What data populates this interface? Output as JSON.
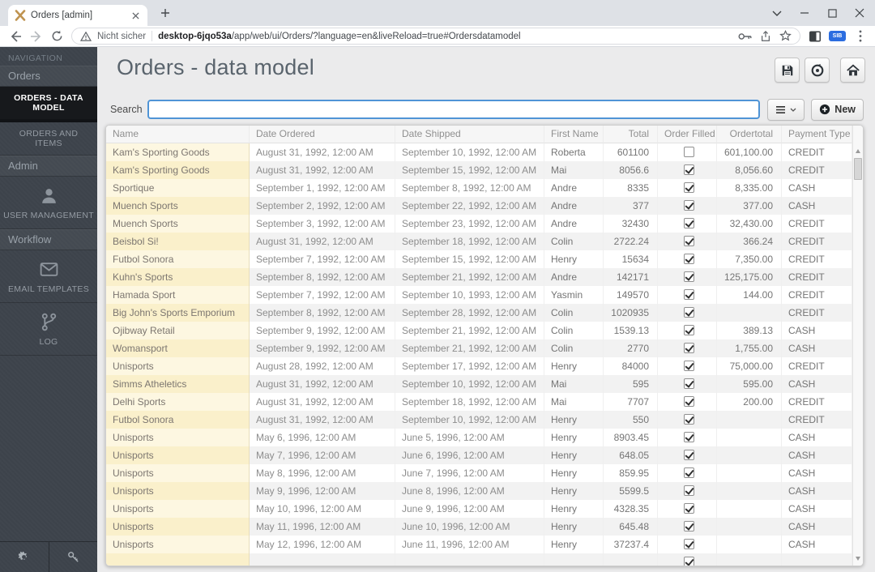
{
  "browser": {
    "tab_title": "Orders [admin]",
    "security_text": "Nicht sicher",
    "url_host": "desktop-6jqo53a",
    "url_rest": "/app/web/ui/Orders/?language=en&liveReload=true#Ordersdatamodel",
    "extension_badge": "SIB"
  },
  "colors": {
    "accent_blue": "#4f94d6",
    "sidebar_bg": "#3d434b",
    "active_item_bg": "#17191c",
    "name_cell_bg": "#fdf7e1",
    "badge_blue": "#2b6de0"
  },
  "sidebar": {
    "items": [
      {
        "type": "caption",
        "label": "NAVIGATION"
      },
      {
        "type": "group",
        "label": "Orders"
      },
      {
        "type": "item",
        "label": "ORDERS - DATA MODEL",
        "active": true
      },
      {
        "type": "item",
        "label": "ORDERS AND ITEMS",
        "active": false
      },
      {
        "type": "group",
        "label": "Admin"
      },
      {
        "type": "icon-item",
        "icon": "user-icon",
        "label": "USER MANAGEMENT"
      },
      {
        "type": "group",
        "label": "Workflow"
      },
      {
        "type": "icon-item",
        "icon": "envelope-icon",
        "label": "EMAIL TEMPLATES"
      },
      {
        "type": "icon-item",
        "icon": "branch-icon",
        "label": "LOG"
      }
    ],
    "footer": [
      {
        "icon": "gear-icon"
      },
      {
        "icon": "key-icon"
      }
    ]
  },
  "main": {
    "title": "Orders - data model",
    "search_label": "Search",
    "search_value": "",
    "new_button_label": "New"
  },
  "table": {
    "columns": [
      {
        "key": "name",
        "label": "Name",
        "align": "left"
      },
      {
        "key": "date_ordered",
        "label": "Date Ordered",
        "align": "left"
      },
      {
        "key": "date_shipped",
        "label": "Date Shipped",
        "align": "left"
      },
      {
        "key": "first_name",
        "label": "First Name",
        "align": "left"
      },
      {
        "key": "total",
        "label": "Total",
        "align": "right"
      },
      {
        "key": "order_filled",
        "label": "Order Filled",
        "align": "center",
        "type": "checkbox"
      },
      {
        "key": "ordertotal",
        "label": "Ordertotal",
        "align": "right"
      },
      {
        "key": "payment_type",
        "label": "Payment Type",
        "align": "left"
      }
    ],
    "rows": [
      {
        "name": "Kam's Sporting Goods",
        "date_ordered": "August 31, 1992, 12:00 AM",
        "date_shipped": "September 10, 1992, 12:00 AM",
        "first_name": "Roberta",
        "total": "601100",
        "order_filled": false,
        "ordertotal": "601,100.00",
        "payment_type": "CREDIT"
      },
      {
        "name": "Kam's Sporting Goods",
        "date_ordered": "August 31, 1992, 12:00 AM",
        "date_shipped": "September 15, 1992, 12:00 AM",
        "first_name": "Mai",
        "total": "8056.6",
        "order_filled": true,
        "ordertotal": "8,056.60",
        "payment_type": "CREDIT"
      },
      {
        "name": "Sportique",
        "date_ordered": "September 1, 1992, 12:00 AM",
        "date_shipped": "September 8, 1992, 12:00 AM",
        "first_name": "Andre",
        "total": "8335",
        "order_filled": true,
        "ordertotal": "8,335.00",
        "payment_type": "CASH"
      },
      {
        "name": "Muench Sports",
        "date_ordered": "September 2, 1992, 12:00 AM",
        "date_shipped": "September 22, 1992, 12:00 AM",
        "first_name": "Andre",
        "total": "377",
        "order_filled": true,
        "ordertotal": "377.00",
        "payment_type": "CASH"
      },
      {
        "name": "Muench Sports",
        "date_ordered": "September 3, 1992, 12:00 AM",
        "date_shipped": "September 23, 1992, 12:00 AM",
        "first_name": "Andre",
        "total": "32430",
        "order_filled": true,
        "ordertotal": "32,430.00",
        "payment_type": "CREDIT"
      },
      {
        "name": "Beisbol Si!",
        "date_ordered": "August 31, 1992, 12:00 AM",
        "date_shipped": "September 18, 1992, 12:00 AM",
        "first_name": "Colin",
        "total": "2722.24",
        "order_filled": true,
        "ordertotal": "366.24",
        "payment_type": "CREDIT"
      },
      {
        "name": "Futbol Sonora",
        "date_ordered": "September 7, 1992, 12:00 AM",
        "date_shipped": "September 15, 1992, 12:00 AM",
        "first_name": "Henry",
        "total": "15634",
        "order_filled": true,
        "ordertotal": "7,350.00",
        "payment_type": "CREDIT"
      },
      {
        "name": "Kuhn's Sports",
        "date_ordered": "September 8, 1992, 12:00 AM",
        "date_shipped": "September 21, 1992, 12:00 AM",
        "first_name": "Andre",
        "total": "142171",
        "order_filled": true,
        "ordertotal": "125,175.00",
        "payment_type": "CREDIT"
      },
      {
        "name": "Hamada Sport",
        "date_ordered": "September 7, 1992, 12:00 AM",
        "date_shipped": "September 10, 1993, 12:00 AM",
        "first_name": "Yasmin",
        "total": "149570",
        "order_filled": true,
        "ordertotal": "144.00",
        "payment_type": "CREDIT"
      },
      {
        "name": "Big John's Sports Emporium",
        "date_ordered": "September 8, 1992, 12:00 AM",
        "date_shipped": "September 28, 1992, 12:00 AM",
        "first_name": "Colin",
        "total": "1020935",
        "order_filled": true,
        "ordertotal": "",
        "payment_type": "CREDIT"
      },
      {
        "name": "Ojibway Retail",
        "date_ordered": "September 9, 1992, 12:00 AM",
        "date_shipped": "September 21, 1992, 12:00 AM",
        "first_name": "Colin",
        "total": "1539.13",
        "order_filled": true,
        "ordertotal": "389.13",
        "payment_type": "CASH"
      },
      {
        "name": "Womansport",
        "date_ordered": "September 9, 1992, 12:00 AM",
        "date_shipped": "September 21, 1992, 12:00 AM",
        "first_name": "Colin",
        "total": "2770",
        "order_filled": true,
        "ordertotal": "1,755.00",
        "payment_type": "CASH"
      },
      {
        "name": "Unisports",
        "date_ordered": "August 28, 1992, 12:00 AM",
        "date_shipped": "September 17, 1992, 12:00 AM",
        "first_name": "Henry",
        "total": "84000",
        "order_filled": true,
        "ordertotal": "75,000.00",
        "payment_type": "CREDIT"
      },
      {
        "name": "Simms Atheletics",
        "date_ordered": "August 31, 1992, 12:00 AM",
        "date_shipped": "September 10, 1992, 12:00 AM",
        "first_name": "Mai",
        "total": "595",
        "order_filled": true,
        "ordertotal": "595.00",
        "payment_type": "CASH"
      },
      {
        "name": "Delhi Sports",
        "date_ordered": "August 31, 1992, 12:00 AM",
        "date_shipped": "September 18, 1992, 12:00 AM",
        "first_name": "Mai",
        "total": "7707",
        "order_filled": true,
        "ordertotal": "200.00",
        "payment_type": "CREDIT"
      },
      {
        "name": "Futbol Sonora",
        "date_ordered": "August 31, 1992, 12:00 AM",
        "date_shipped": "September 10, 1992, 12:00 AM",
        "first_name": "Henry",
        "total": "550",
        "order_filled": true,
        "ordertotal": "",
        "payment_type": "CREDIT"
      },
      {
        "name": "Unisports",
        "date_ordered": "May 6, 1996, 12:00 AM",
        "date_shipped": "June 5, 1996, 12:00 AM",
        "first_name": "Henry",
        "total": "8903.45",
        "order_filled": true,
        "ordertotal": "",
        "payment_type": "CASH"
      },
      {
        "name": "Unisports",
        "date_ordered": "May 7, 1996, 12:00 AM",
        "date_shipped": "June 6, 1996, 12:00 AM",
        "first_name": "Henry",
        "total": "648.05",
        "order_filled": true,
        "ordertotal": "",
        "payment_type": "CASH"
      },
      {
        "name": "Unisports",
        "date_ordered": "May 8, 1996, 12:00 AM",
        "date_shipped": "June 7, 1996, 12:00 AM",
        "first_name": "Henry",
        "total": "859.95",
        "order_filled": true,
        "ordertotal": "",
        "payment_type": "CASH"
      },
      {
        "name": "Unisports",
        "date_ordered": "May 9, 1996, 12:00 AM",
        "date_shipped": "June 8, 1996, 12:00 AM",
        "first_name": "Henry",
        "total": "5599.5",
        "order_filled": true,
        "ordertotal": "",
        "payment_type": "CASH"
      },
      {
        "name": "Unisports",
        "date_ordered": "May 10, 1996, 12:00 AM",
        "date_shipped": "June 9, 1996, 12:00 AM",
        "first_name": "Henry",
        "total": "4328.35",
        "order_filled": true,
        "ordertotal": "",
        "payment_type": "CASH"
      },
      {
        "name": "Unisports",
        "date_ordered": "May 11, 1996, 12:00 AM",
        "date_shipped": "June 10, 1996, 12:00 AM",
        "first_name": "Henry",
        "total": "645.48",
        "order_filled": true,
        "ordertotal": "",
        "payment_type": "CASH"
      },
      {
        "name": "Unisports",
        "date_ordered": "May 12, 1996, 12:00 AM",
        "date_shipped": "June 11, 1996, 12:00 AM",
        "first_name": "Henry",
        "total": "37237.4",
        "order_filled": true,
        "ordertotal": "",
        "payment_type": "CASH"
      }
    ],
    "partial_row": {
      "name": "",
      "date_ordered": "",
      "date_shipped": "",
      "first_name": "",
      "total": "",
      "order_filled": true,
      "ordertotal": "",
      "payment_type": ""
    }
  }
}
